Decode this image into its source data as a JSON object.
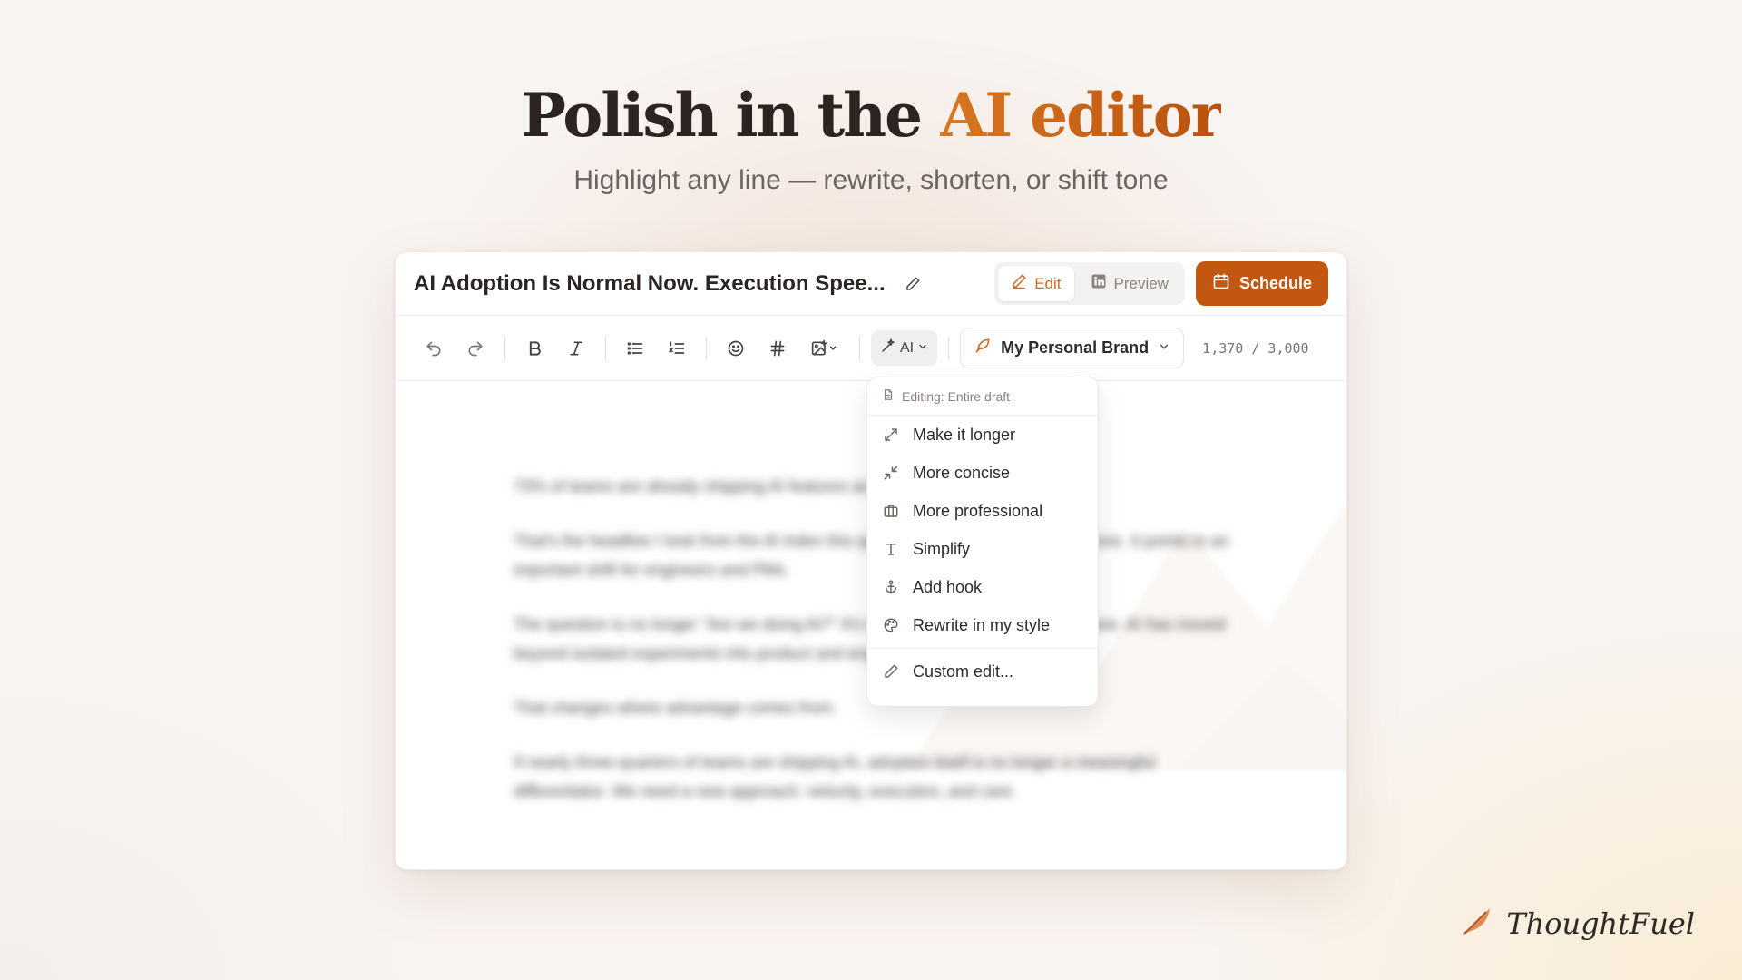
{
  "hero": {
    "title_prefix": "Polish in the ",
    "title_accent": "AI editor",
    "subtitle": "Highlight any line — rewrite, shorten, or shift tone"
  },
  "editor": {
    "doc_title": "AI Adoption Is Normal Now. Execution Spee...",
    "modes": {
      "edit": "Edit",
      "preview": "Preview"
    },
    "schedule_label": "Schedule",
    "toolbar": {
      "ai_label": "AI",
      "brand": "My Personal Brand",
      "char_count": "1,370 / 3,000"
    },
    "body_paragraphs": [
      "73% of teams are already shipping AI features across products in 2024.",
      "That's the headline I took from the AI index this quarter, and the finding I can't ignore. It points to an important shift for engineers and PMs.",
      "The question is no longer \"Are we doing AI?\" It's whether your team is already there. AI has moved beyond isolated experiments into product and engineering roadmaps.",
      "That changes where advantage comes from.",
      "If nearly three-quarters of teams are shipping AI, adoption itself is no longer a meaningful differentiator. We need a new approach: velocity, execution, and care."
    ]
  },
  "ai_menu": {
    "header": "Editing: Entire draft",
    "items": [
      {
        "label": "Make it longer",
        "icon": "expand-icon"
      },
      {
        "label": "More concise",
        "icon": "collapse-icon"
      },
      {
        "label": "More professional",
        "icon": "briefcase-icon"
      },
      {
        "label": "Simplify",
        "icon": "text-t-icon"
      },
      {
        "label": "Add hook",
        "icon": "anchor-icon"
      },
      {
        "label": "Rewrite in my style",
        "icon": "palette-icon"
      }
    ],
    "custom": "Custom edit..."
  },
  "brand": {
    "name": "ThoughtFuel"
  },
  "colors": {
    "accent": "#c2580f",
    "accent_light": "#d9761f"
  }
}
